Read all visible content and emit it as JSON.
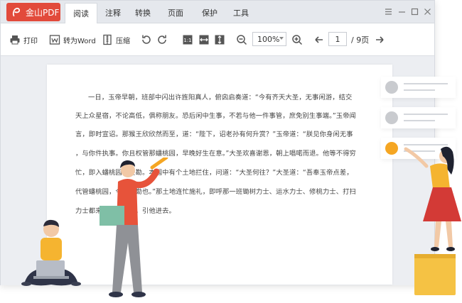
{
  "app": {
    "title": "金山PDF"
  },
  "menu": [
    "阅读",
    "注释",
    "转换",
    "页面",
    "保护",
    "工具"
  ],
  "toolbar": {
    "print": "打印",
    "to_word": "转为Word",
    "compress": "压缩",
    "zoom": "100%",
    "page": "1",
    "total": "/ 9页"
  },
  "document": {
    "lines": [
      "一日，玉帝早朝，班部中闪出许旌阳真人，俯囟启奏道：“今有齐天大圣，无事闲游，结交",
      "天上众星宿，不论高低，俱称朋友。恐后闲中生事，不若与他一件事管，庶免别生事端。”玉帝闻",
      "言，即时宣诏。那猴王欣欣然而至，道：“陛下，诏老孙有何升赏？”玉帝道：“朕见你身闲无事",
      "，与你件执事。你且权管那蟠桃园，早晚好生在意。”大圣欢喜谢恩，朝上唱喏而退。他等不得穷",
      "忙，即入蟠桃园内查勘。本园中有个土地拦住，问道：“大圣何往？”大圣道：“吾奉玉帝点差，",
      "代管蟠桃园，今来查勘也。”那土地连忙施礼，即呼那一班锄树力士、运水力士、修桃力士、打扫",
      "力士都来见大圣磕头，引他进去。"
    ]
  },
  "colors": {
    "brand": "#e24a3b",
    "accent_orange": "#f5a623",
    "gray_dot": "#c9cbcf"
  }
}
